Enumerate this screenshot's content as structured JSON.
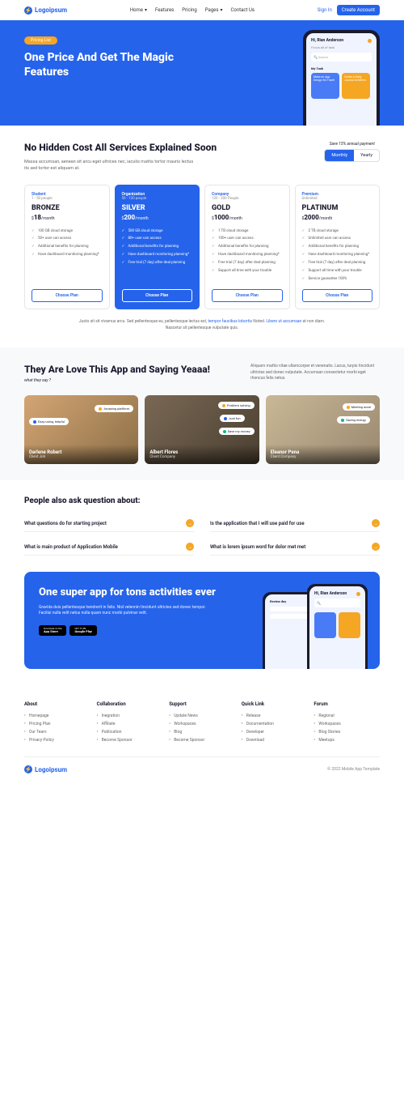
{
  "header": {
    "logo": "Logoipsum",
    "nav": [
      "Home",
      "Features",
      "Pricing",
      "Pages",
      "Contact Us"
    ],
    "signIn": "Sign In",
    "createAccount": "Create Account"
  },
  "hero": {
    "pill": "Pricing List",
    "title": "One Price And Get The Magic Features",
    "phone": {
      "greeting": "Hi, Rian Anderson",
      "sub": "Focus all of task",
      "search": "Search",
      "taskLabel": "My Task",
      "card1": "Make an App Design for Travel",
      "card2": "Create a Daily Journal Activities"
    }
  },
  "pricingIntro": {
    "title": "No Hidden Cost All Services Explained Soon",
    "desc": "Massa accumsan, aenean sit arcu eget ultrices nec, iaculis mattis tortor mauris lectus its sed tortor est aliquam at.",
    "save": "Save 15% annual payment",
    "monthly": "Monthly",
    "yearly": "Yearly"
  },
  "plans": [
    {
      "label": "Student",
      "people": "1 - 50 people",
      "name": "BRONZE",
      "price": "18",
      "period": "/month",
      "features": [
        "100 GB cloud storage",
        "50+ user can access",
        "Additional benefits for planning",
        "Have dashboard monitoring planning*"
      ],
      "btn": "Choose Plan"
    },
    {
      "label": "Organization",
      "people": "50 - 120 people",
      "name": "SILVER",
      "price": "200",
      "period": "/month",
      "features": [
        "500 GB cloud storage",
        "80+ user can access",
        "Additional benefits for planning",
        "Have dashboard monitoring planning*",
        "Free trial (7 day) after deal planning"
      ],
      "btn": "Choose Plan"
    },
    {
      "label": "Company",
      "people": "120 - 200 People",
      "name": "GOLD",
      "price": "1000",
      "period": "/month",
      "features": [
        "1 TB cloud storage",
        "100+ user can access",
        "Additional benefits for planning",
        "Have dashboard monitoring planning*",
        "Free trial (7 day) after deal planning",
        "Support all time with your trouble"
      ],
      "btn": "Choose Plan"
    },
    {
      "label": "Premium",
      "people": "Unlimited",
      "name": "PLATINUM",
      "price": "2000",
      "period": "/month",
      "features": [
        "2 TB cloud storage",
        "Unlimited user can access",
        "Additional benefits for planning",
        "Have dashboard monitoring planning*",
        "Free trial (7 day) after deal planning",
        "Support all time with your trouble",
        "Service guarantee 100%"
      ],
      "btn": "Choose Plan"
    }
  ],
  "footnote": {
    "p1": "Justo sit sit vivamus arcu. Sed pellentesque eu, pellentesque lectus est, ",
    "link1": "tempor faucibus lobortis",
    "p2": " Noted. ",
    "link2": "Libero ut accumsan",
    "p3": " at non diam. Nascetur sit pellentesque vulputate quis."
  },
  "testimonials": {
    "title": "They Are Love This App and Saying Yeaaa!",
    "sub": "what they say ?",
    "desc": "Aliquam mattis vitae ullamcorper et venenatis. Lacus, turpis tincidunt ultricies sed donec vulputate. Accumsan consectetur morbi eget rhoncus felis netus.",
    "cards": [
      {
        "name": "Darlene Robert",
        "role": "Client Job",
        "b1": "Amazing platform",
        "b2": "Easy using, helpful"
      },
      {
        "name": "Albert Flores",
        "role": "Client Company",
        "b1": "Problem solving",
        "b2": "Just fun",
        "b3": "Save my money"
      },
      {
        "name": "Eleanor Pena",
        "role": "Client Company",
        "b1": "Meeting done",
        "b2": "Saving energy"
      }
    ]
  },
  "faq": {
    "title": "People also ask question about:",
    "items": [
      "What questions do for starting project",
      "Is the application that I will use paid for use",
      "What is main product of Application Mobile",
      "What is lorem ipsum word for dolor met met"
    ]
  },
  "cta": {
    "title": "One super app for tons activities ever",
    "desc": "Gravida duis pellentesque hendrerit in felis. Nisl velennin tincidunt ultricies sed donec tempor. Facilisi nulla velit netus nulla quam nunc morbi pulvinar velit.",
    "appstore": {
      "top": "Download on the",
      "main": "App Store"
    },
    "playstore": {
      "top": "GET IT ON",
      "main": "Google Play"
    },
    "phone": {
      "greeting": "Hi, Rian Anderson",
      "review": "Review day"
    }
  },
  "footer": {
    "cols": [
      {
        "title": "About",
        "items": [
          "Homepage",
          "Pricing Plan",
          "Our Team",
          "Privacy Policy"
        ]
      },
      {
        "title": "Collaboration",
        "items": [
          "Inegration",
          "Affiliate",
          "Publication",
          "Become Sponsor"
        ]
      },
      {
        "title": "Support",
        "items": [
          "Update News",
          "Workspaces",
          "Blog",
          "Become Sponsor"
        ]
      },
      {
        "title": "Quick Link",
        "items": [
          "Release",
          "Documentation",
          "Developer",
          "Download"
        ]
      },
      {
        "title": "Forum",
        "items": [
          "Regional",
          "Workspaces",
          "Blog Stories",
          "Meetups"
        ]
      }
    ],
    "logo": "Logoipsum",
    "copyright": "© 2022 Mobile App Template"
  }
}
